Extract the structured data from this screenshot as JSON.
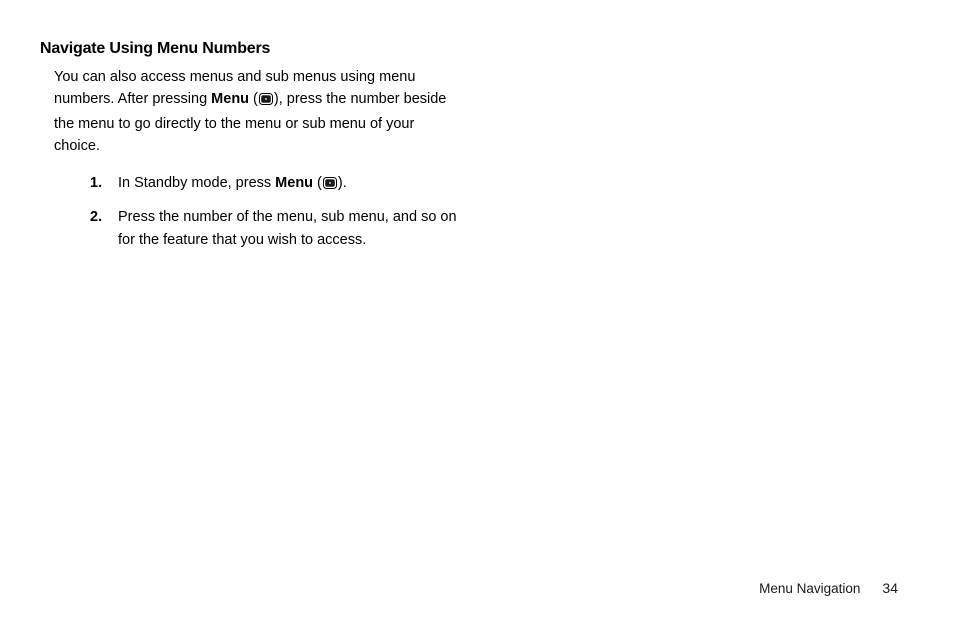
{
  "heading": "Navigate Using Menu Numbers",
  "intro": {
    "pre": "You can also access menus and sub menus using menu numbers. After pressing ",
    "menu_label": "Menu",
    "mid": " (",
    "post": "), press the number beside the menu to go directly to the menu or sub menu of your choice."
  },
  "steps": [
    {
      "num": "1.",
      "pre": "In Standby mode, press ",
      "menu_label": "Menu",
      "mid": " (",
      "post": ")."
    },
    {
      "num": "2.",
      "text": "Press the number of the menu, sub menu, and so on for the feature that you wish to access."
    }
  ],
  "footer": {
    "section": "Menu Navigation",
    "page": "34"
  }
}
